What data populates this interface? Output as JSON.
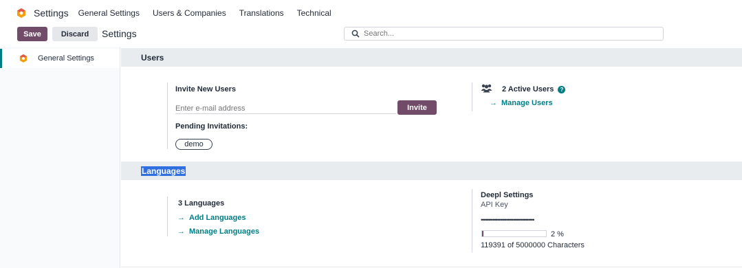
{
  "navbar": {
    "app_title": "Settings",
    "menu": [
      "General Settings",
      "Users & Companies",
      "Translations",
      "Technical"
    ]
  },
  "control": {
    "save_label": "Save",
    "discard_label": "Discard",
    "breadcrumb": "Settings",
    "search_placeholder": "Search..."
  },
  "sidebar": {
    "items": [
      {
        "label": "General Settings"
      }
    ]
  },
  "users": {
    "section_title": "Users",
    "invite_title": "Invite New Users",
    "email_placeholder": "Enter e-mail address",
    "invite_button": "Invite",
    "pending_title": "Pending Invitations:",
    "pending": [
      "demo"
    ],
    "active_users": "2 Active Users",
    "manage_users": "Manage Users"
  },
  "languages": {
    "section_title": "Languages",
    "count_text": "3 Languages",
    "add_link": "Add Languages",
    "manage_link": "Manage Languages",
    "deepl_title": "Deepl Settings",
    "api_key_label": "API Key",
    "api_key_value": "••••••••••••••••••••••••••••••••••••",
    "usage_percent": 2,
    "usage_percent_label": "2 %",
    "usage_text": "119391 of 5000000 Characters"
  },
  "colors": {
    "brand": "#714b67",
    "accent": "#017e84",
    "selection": "#2f6fe0"
  },
  "icons": {
    "app_logo": "odoo-settings-logo-icon",
    "search": "search-icon",
    "users": "users-group-icon",
    "help": "help-circle-icon",
    "arrow": "arrow-right-icon"
  }
}
